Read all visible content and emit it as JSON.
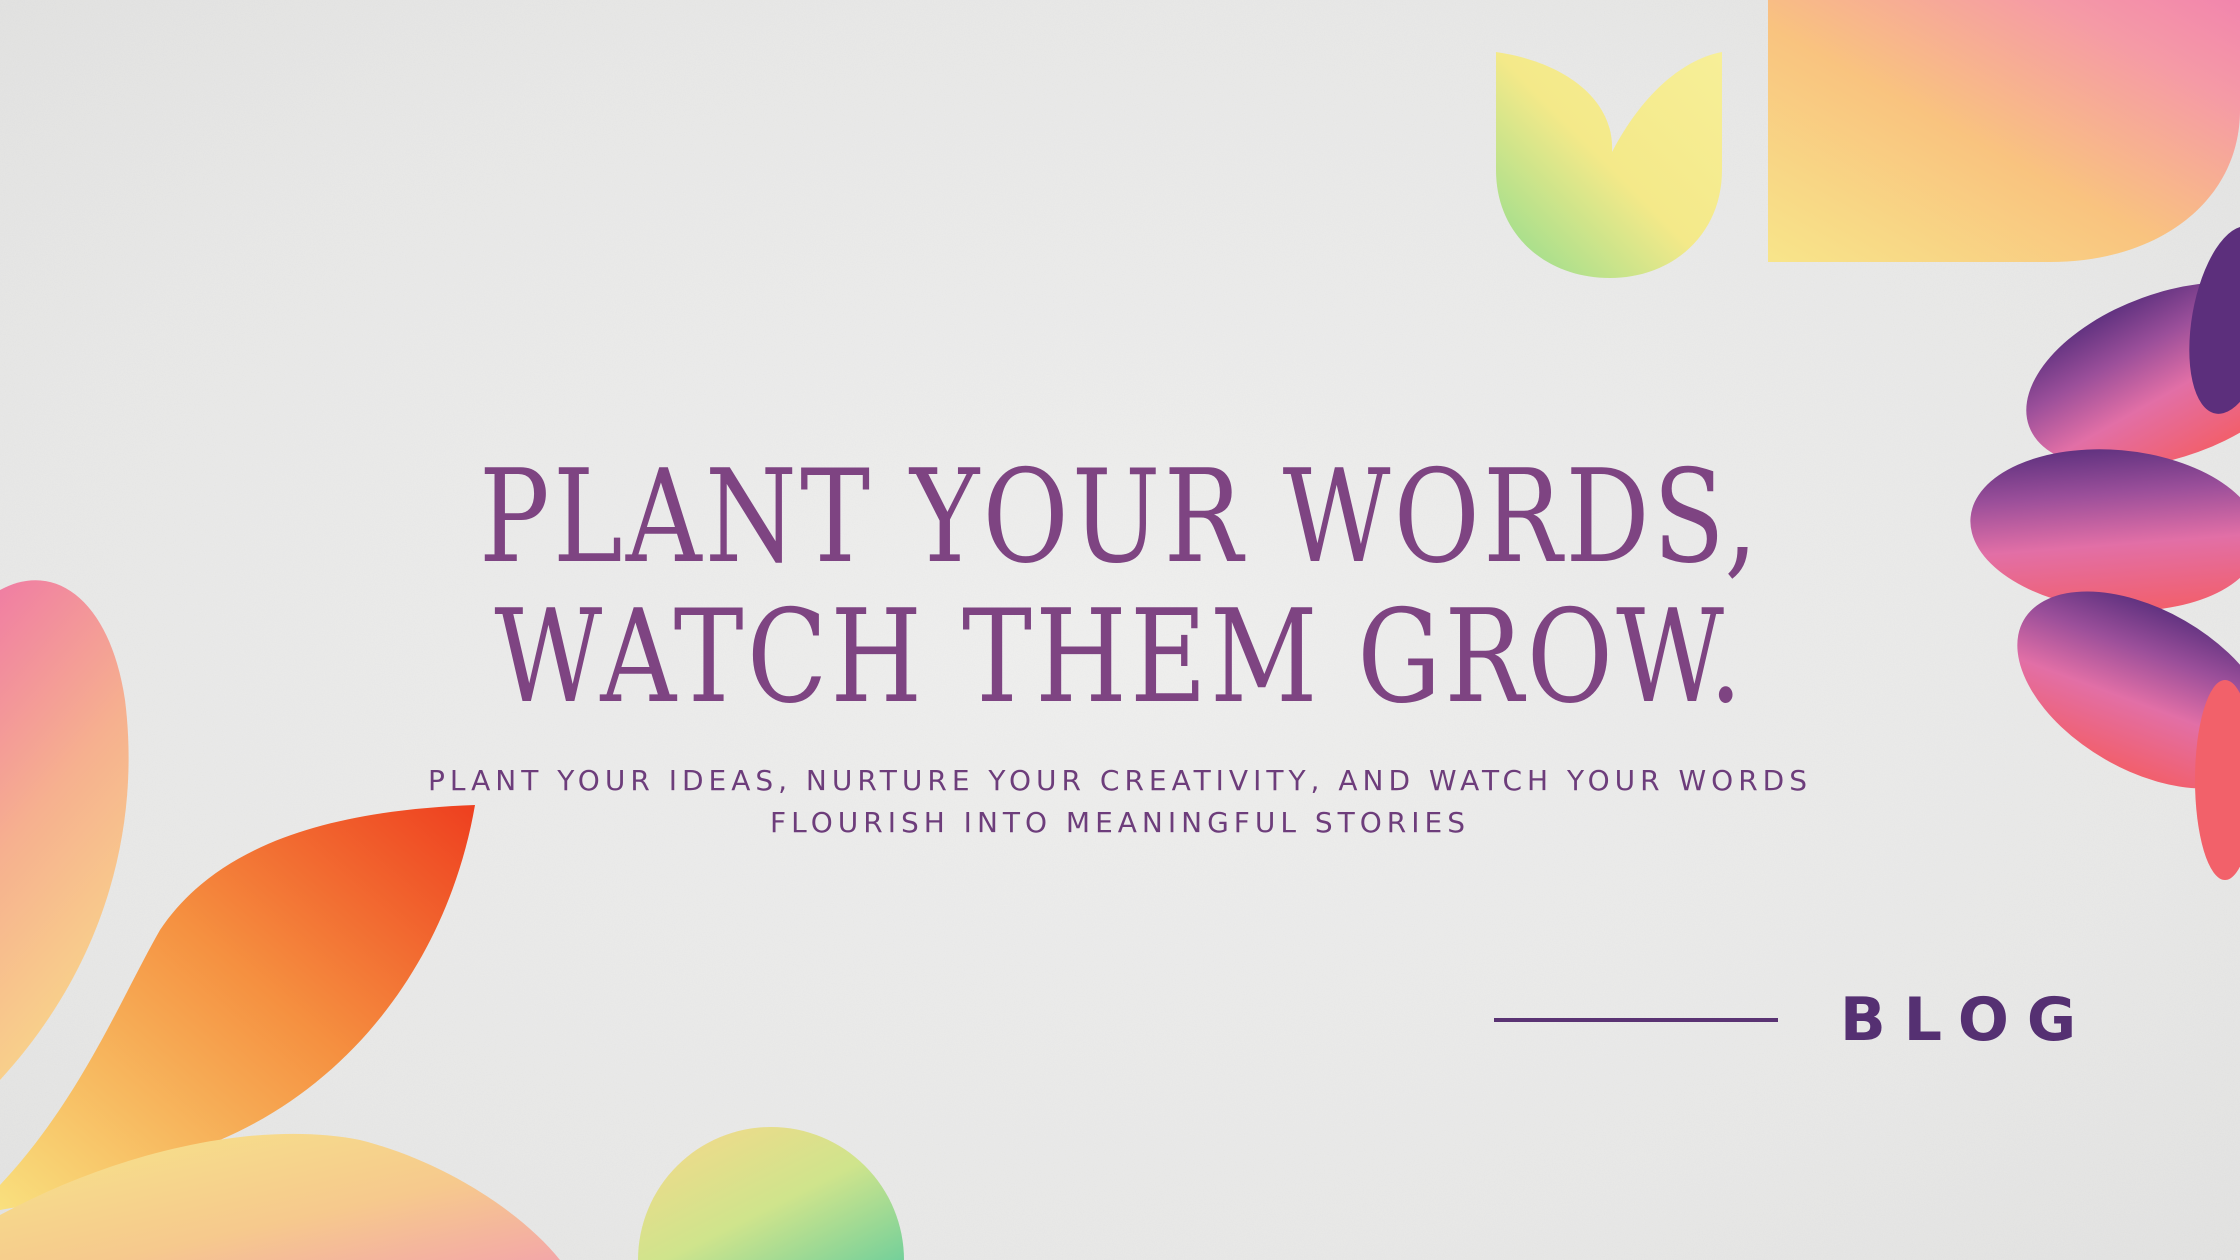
{
  "hero": {
    "headline": "Plant Your Words, Watch Them Grow.",
    "subhead": "Plant your ideas, nurture your creativity, and watch your words flourish into meaningful stories"
  },
  "badge": {
    "label": "BLOG"
  },
  "decorations": {
    "top_tulip": "tulip-shape",
    "top_right_block": "rounded-square-shape",
    "right_flower": "flower-shape",
    "left_leaves": "leaf-shapes",
    "bottom_circle": "circle-shape"
  },
  "colors": {
    "text_primary": "#7e4482",
    "text_secondary": "#6d3d7b",
    "accent_dark": "#553072",
    "background": "#ebebea"
  }
}
